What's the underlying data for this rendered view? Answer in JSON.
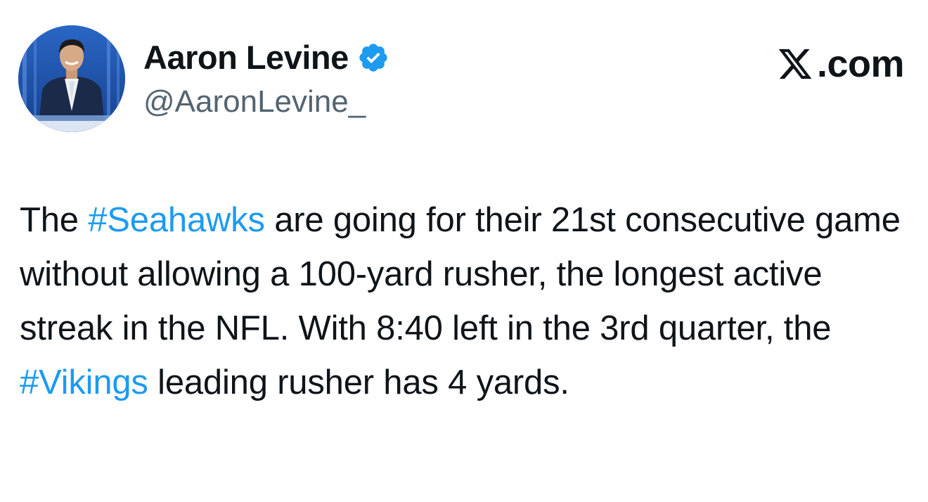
{
  "author": {
    "display_name": "Aaron Levine",
    "handle": "@AaronLevine_",
    "verified": true,
    "avatar_icon": "person-portrait"
  },
  "brand": {
    "label": ".com",
    "logo_icon": "x-logo-icon"
  },
  "tweet": {
    "segments": [
      {
        "text": "The ",
        "type": "text"
      },
      {
        "text": "#Seahawks",
        "type": "hashtag"
      },
      {
        "text": " are going for their 21st consecutive game without allowing a 100-yard rusher, the longest active streak in the NFL. With 8:40 left in the 3rd quarter, the ",
        "type": "text"
      },
      {
        "text": "#Vikings",
        "type": "hashtag"
      },
      {
        "text": " leading rusher has 4 yards.",
        "type": "text"
      }
    ]
  },
  "colors": {
    "hashtag": "#1d9bf0",
    "verified_badge": "#1d9bf0",
    "text": "#0f1419",
    "handle": "#536471"
  }
}
